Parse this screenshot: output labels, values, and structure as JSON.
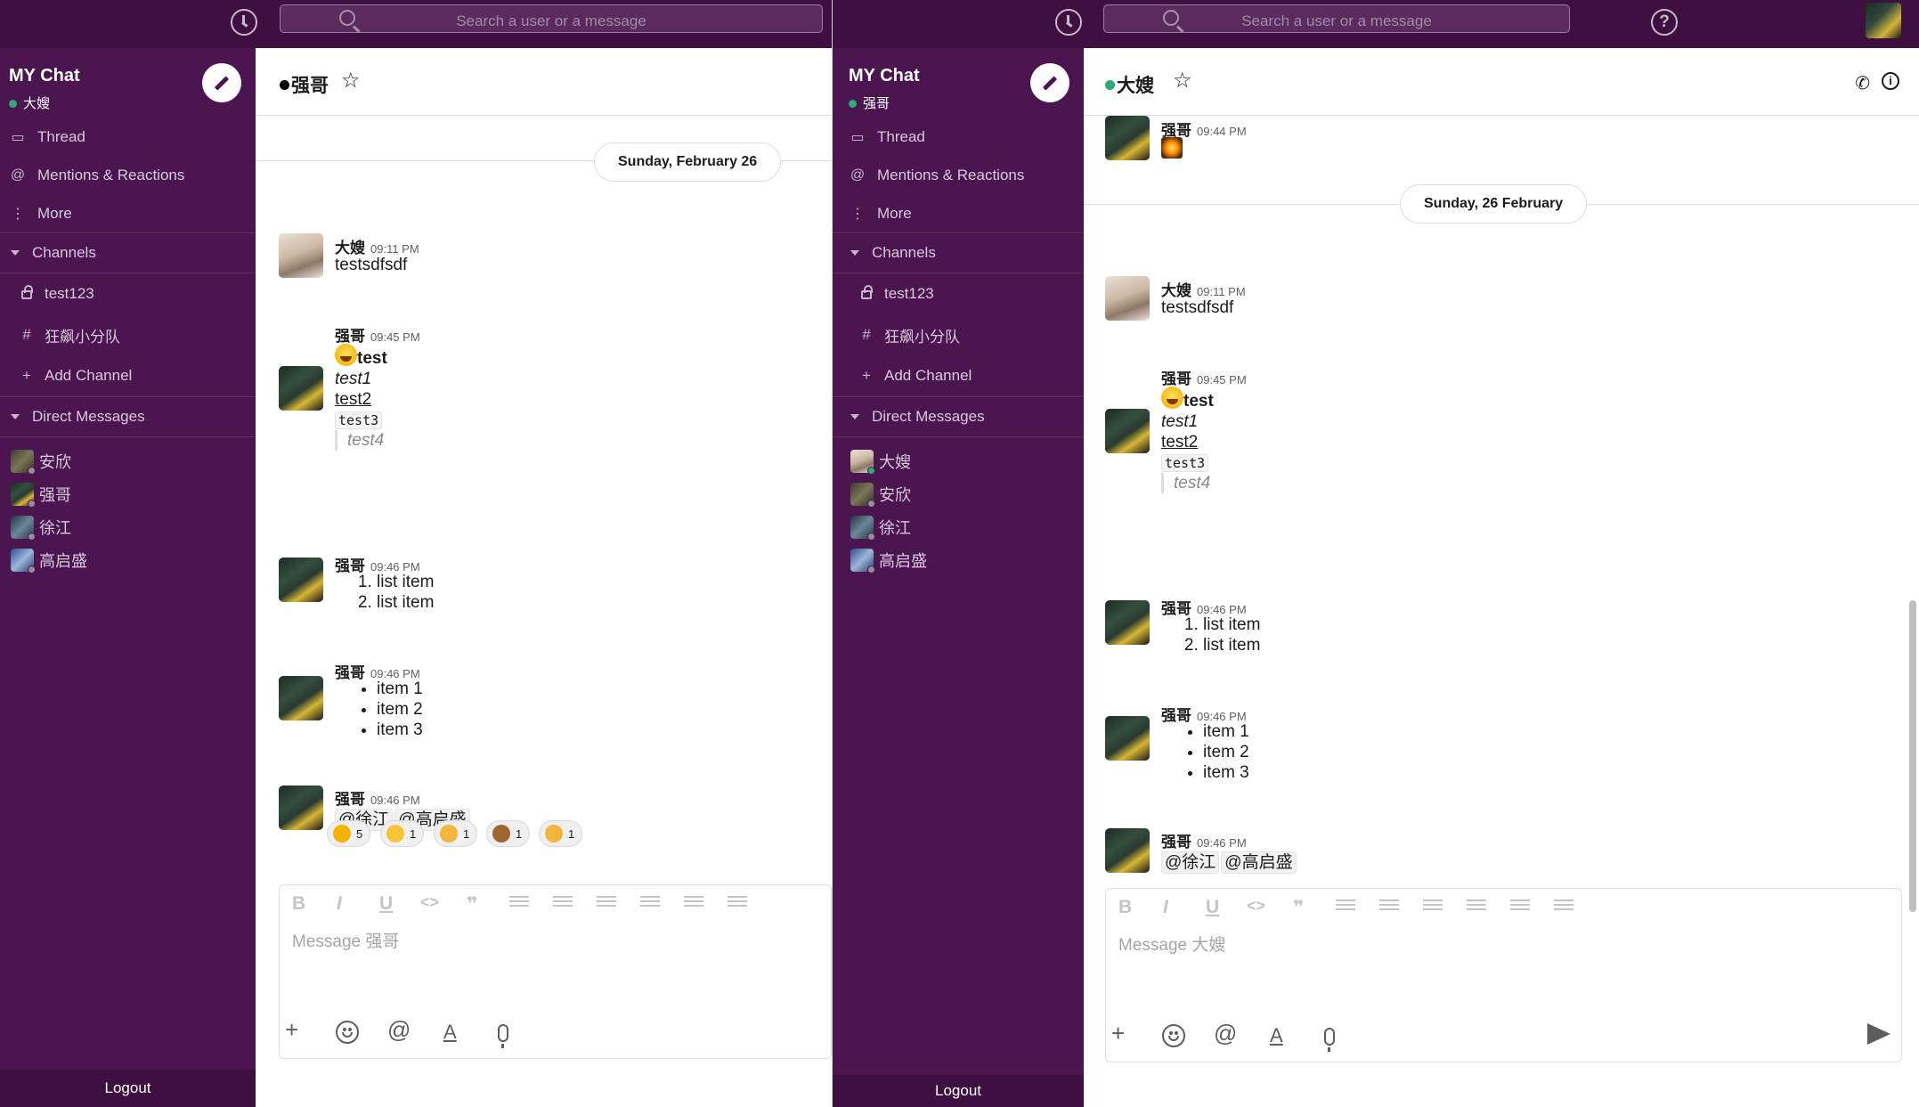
{
  "left": {
    "search_placeholder": "Search a user or a message",
    "workspace": {
      "name": "MY Chat",
      "user": "大嫂"
    },
    "nav": [
      "Thread",
      "Mentions & Reactions",
      "More"
    ],
    "channels_label": "Channels",
    "channels": [
      "test123",
      "狂飙小分队"
    ],
    "add_channel": "Add Channel",
    "dm_label": "Direct Messages",
    "dms": [
      "安欣",
      "强哥",
      "徐江",
      "高启盛"
    ],
    "logout": "Logout",
    "chat_title": "强哥",
    "date_label": "Sunday, February 26",
    "messages": {
      "m1": {
        "author": "大嫂",
        "time": "09:11 PM",
        "text": "testsdfsdf"
      },
      "m2": {
        "author": "强哥",
        "time": "09:45 PM",
        "bold": "test",
        "italic": "test1",
        "underline": "test2",
        "code": "test3",
        "quote": "test4"
      },
      "m3": {
        "author": "强哥",
        "time": "09:46 PM",
        "items": [
          "list item",
          "list item"
        ]
      },
      "m4": {
        "author": "强哥",
        "time": "09:46 PM",
        "items": [
          "item 1",
          "item 2",
          "item 3"
        ]
      },
      "m5": {
        "author": "强哥",
        "time": "09:46 PM",
        "mentions": [
          "@徐江",
          "@高启盛"
        ]
      }
    },
    "reactions": [
      "5",
      "1",
      "1",
      "1",
      "1"
    ],
    "composer_placeholder": "Message 强哥"
  },
  "right": {
    "search_placeholder": "Search a user or a message",
    "workspace": {
      "name": "MY Chat",
      "user": "强哥"
    },
    "nav": [
      "Thread",
      "Mentions & Reactions",
      "More"
    ],
    "channels_label": "Channels",
    "channels": [
      "test123",
      "狂飙小分队"
    ],
    "add_channel": "Add Channel",
    "dm_label": "Direct Messages",
    "dms": [
      "大嫂",
      "安欣",
      "徐江",
      "高启盛"
    ],
    "logout": "Logout",
    "chat_title": "大嫂",
    "top_message_time": "09:44 PM",
    "top_message_author": "强哥",
    "date_label": "Sunday, 26 February",
    "messages": {
      "m1": {
        "author": "大嫂",
        "time": "09:11 PM",
        "text": "testsdfsdf"
      },
      "m2": {
        "author": "强哥",
        "time": "09:45 PM",
        "bold": "test",
        "italic": "test1",
        "underline": "test2",
        "code": "test3",
        "quote": "test4"
      },
      "m3": {
        "author": "强哥",
        "time": "09:46 PM",
        "items": [
          "list item",
          "list item"
        ]
      },
      "m4": {
        "author": "强哥",
        "time": "09:46 PM",
        "items": [
          "item 1",
          "item 2",
          "item 3"
        ]
      },
      "m5": {
        "author": "强哥",
        "time": "09:46 PM",
        "mentions": [
          "@徐江",
          "@高启盛"
        ]
      }
    },
    "composer_placeholder": "Message 大嫂"
  },
  "colors": {
    "sidebar": "#4b1650",
    "topbar": "#3e1040",
    "online": "#2bac76"
  },
  "icons": [
    "clock-icon",
    "search-icon",
    "help-icon",
    "compose-icon",
    "star-icon",
    "phone-icon",
    "info-icon",
    "send-icon"
  ]
}
